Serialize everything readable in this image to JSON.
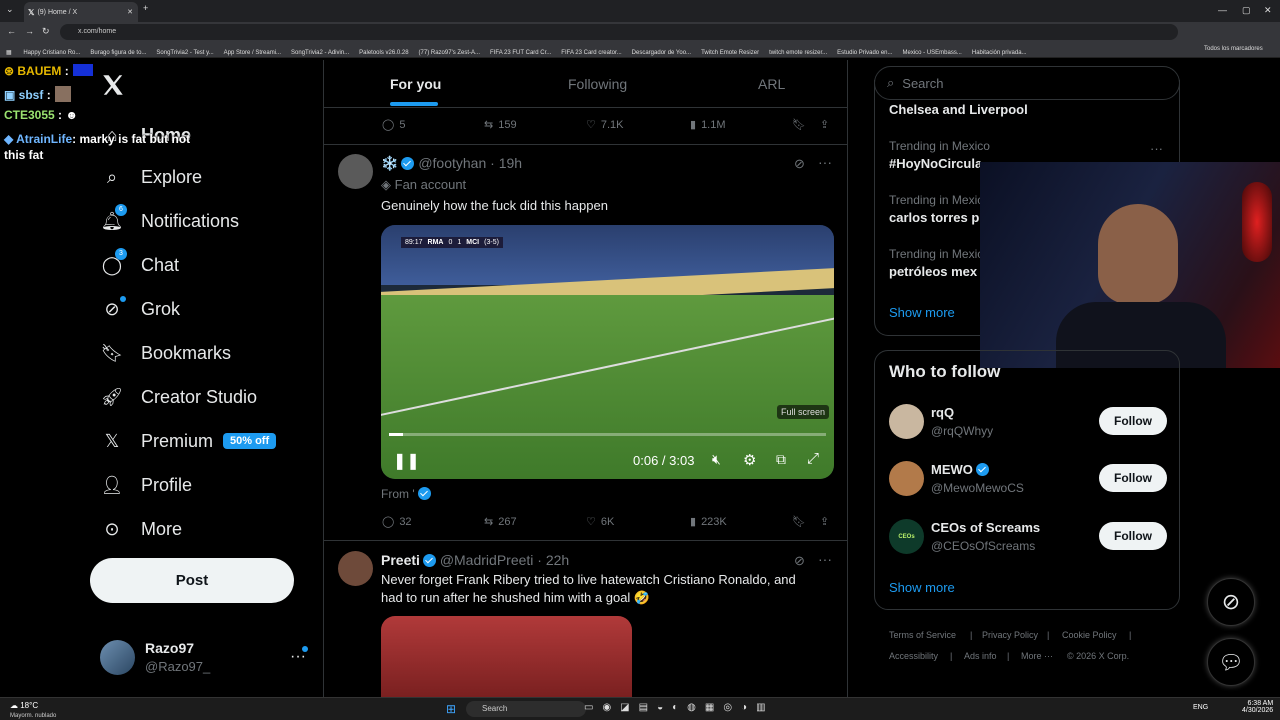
{
  "browser": {
    "tab_title": "(9) Home / X",
    "url": "x.com/home",
    "bookmarks": [
      "Happy Cristiano Ro...",
      "Burago figura de to...",
      "SongTrivia2 - Test y...",
      "App Store / Streami...",
      "SongTrivia2 - Adivin...",
      "Paletools v26.0.28",
      "(77) Razo97's Zest-A...",
      "FIFA 23 FUT Card Cr...",
      "FIFA 23 Card creator...",
      "Descargador de Yoo...",
      "Twitch Emote Resizer",
      "twitch emote resizer...",
      "Estudio Privado en...",
      "Mexico - USEmbass...",
      "Habitación privada..."
    ],
    "all_bookmarks": "Todos los marcadores"
  },
  "nav": {
    "items": [
      {
        "label": "Home",
        "icon": "home-icon"
      },
      {
        "label": "Explore",
        "icon": "search-icon"
      },
      {
        "label": "Notifications",
        "icon": "bell-icon",
        "badge": "6"
      },
      {
        "label": "Chat",
        "icon": "chat-icon",
        "badge": "3"
      },
      {
        "label": "Grok",
        "icon": "grok-icon"
      },
      {
        "label": "Bookmarks",
        "icon": "bookmark-icon"
      },
      {
        "label": "Creator Studio",
        "icon": "rocket-icon"
      },
      {
        "label": "Premium",
        "icon": "x-logo-icon",
        "tag": "50% off"
      },
      {
        "label": "Profile",
        "icon": "person-icon"
      },
      {
        "label": "More",
        "icon": "more-circle-icon"
      }
    ],
    "post_label": "Post",
    "account": {
      "name": "Razo97",
      "handle": "@Razo97_"
    }
  },
  "chat_overlay": [
    {
      "user": "BAUEM",
      "msg": ":"
    },
    {
      "user": "sbsf",
      "msg": ":"
    },
    {
      "user": "CTE3055",
      "msg": ":"
    },
    {
      "user": "AtrainLife",
      "msg": ": marky is fat but not this fat"
    }
  ],
  "feed": {
    "tabs": [
      "For you",
      "Following",
      "ARL"
    ],
    "prev_actions": {
      "replies": "5",
      "reposts": "159",
      "likes": "7.1K",
      "views": "1.1M"
    },
    "posts": [
      {
        "display_emoji": "❄️",
        "handle": "@footyhan",
        "time": "19h",
        "sub": "Fan account",
        "text": "Genuinely how the fuck did this happen",
        "video": {
          "scoreboard": {
            "clock": "89:17",
            "home": "RMA",
            "home_score": "0",
            "away_score": "1",
            "away": "MCI",
            "agg": "(3-5)"
          },
          "tooltip": "Full screen",
          "time": "0:06 / 3:03",
          "progress": 0.033
        },
        "from_label": "From '",
        "actions": {
          "replies": "32",
          "reposts": "267",
          "likes": "6K",
          "views": "223K"
        }
      },
      {
        "name": "Preeti",
        "handle": "@MadridPreeti",
        "time": "22h",
        "text": "Never forget Frank Ribery tried to live hatewatch Cristiano Ronaldo, and had to run after he shushed him with a goal 🤣"
      }
    ]
  },
  "right": {
    "search_placeholder": "Search",
    "trends": [
      {
        "category": "",
        "name": "Chelsea and Liverpool"
      },
      {
        "category": "Trending in Mexico",
        "name": "#HoyNoCircula"
      },
      {
        "category": "Trending in Mexico",
        "name": "carlos torres p"
      },
      {
        "category": "Trending in Mexico",
        "name": "petróleos mex"
      }
    ],
    "show_more": "Show more",
    "who_to_follow_title": "Who to follow",
    "who_to_follow": [
      {
        "name": "rqQ",
        "handle": "@rqQWhyy",
        "verified": false
      },
      {
        "name": "MEWO",
        "handle": "@MewoMewoCS",
        "verified": true
      },
      {
        "name": "CEOs of Screams",
        "handle": "@CEOsOfScreams",
        "verified": false
      }
    ],
    "follow_label": "Follow",
    "footer": [
      "Terms of Service",
      "|",
      "Privacy Policy",
      "|",
      "Cookie Policy",
      "|",
      "Accessibility",
      "|",
      "Ads info",
      "|",
      "More ···",
      "© 2026 X Corp."
    ]
  },
  "taskbar": {
    "weather_temp": "18°C",
    "weather_desc": "Mayorm. nublado",
    "search": "Search",
    "lang": "ENG",
    "time": "6:38 AM",
    "date": "4/30/2026"
  }
}
